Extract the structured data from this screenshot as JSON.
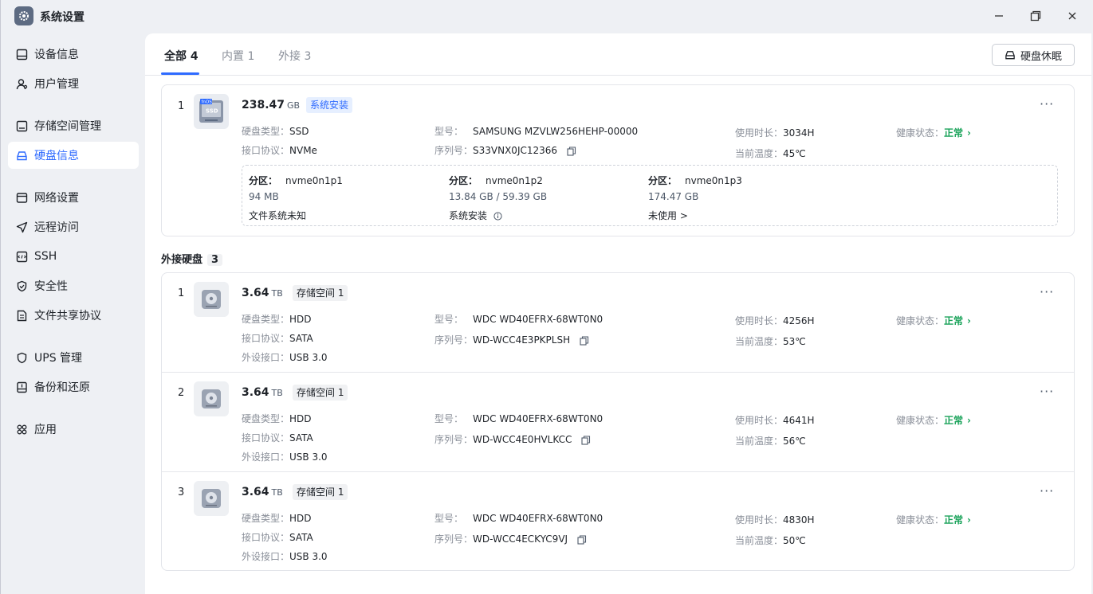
{
  "app": {
    "title": "系统设置"
  },
  "sidebar": {
    "items": [
      {
        "label": "设备信息",
        "icon": "device-info-icon"
      },
      {
        "label": "用户管理",
        "icon": "user-icon"
      },
      {
        "label": "存储空间管理",
        "icon": "storage-icon"
      },
      {
        "label": "硬盘信息",
        "icon": "disk-icon",
        "active": true
      },
      {
        "label": "网络设置",
        "icon": "network-icon"
      },
      {
        "label": "远程访问",
        "icon": "remote-icon"
      },
      {
        "label": "SSH",
        "icon": "ssh-icon"
      },
      {
        "label": "安全性",
        "icon": "shield-icon"
      },
      {
        "label": "文件共享协议",
        "icon": "file-share-icon"
      },
      {
        "label": "UPS 管理",
        "icon": "ups-icon"
      },
      {
        "label": "备份和还原",
        "icon": "backup-icon"
      },
      {
        "label": "应用",
        "icon": "apps-icon"
      }
    ]
  },
  "tabs": [
    {
      "label": "全部 4",
      "active": true
    },
    {
      "label": "内置 1"
    },
    {
      "label": "外接 3"
    }
  ],
  "toolbar": {
    "sleep_label": "硬盘休眠"
  },
  "labels": {
    "type": "硬盘类型：",
    "iface": "接口协议：",
    "ext_iface": "外设接口：",
    "model": "型号：",
    "serial": "序列号：",
    "uptime": "使用时长：",
    "temp": "当前温度：",
    "health": "健康状态：",
    "partition": "分区：",
    "more": "···"
  },
  "internal_disk": {
    "index": "1",
    "icon_text": "fnOS",
    "icon_sub": "SSD",
    "capacity": "238.47",
    "unit": "GB",
    "badge": "系统安装",
    "type": "SSD",
    "iface": "NVMe",
    "model": "SAMSUNG MZVLW256HEHP-00000",
    "serial": "S33VNX0JC12366",
    "uptime": "3034H",
    "temp": "45℃",
    "health": "正常",
    "partitions": [
      {
        "name": "nvme0n1p1",
        "size": "94 MB",
        "fs": "文件系统未知"
      },
      {
        "name": "nvme0n1p2",
        "size": "13.84 GB / 59.39 GB",
        "fs": "系统安装"
      },
      {
        "name": "nvme0n1p3",
        "size": "174.47 GB",
        "fs": "未使用 >"
      }
    ]
  },
  "external_section": {
    "title": "外接硬盘",
    "count": "3"
  },
  "external_disks": [
    {
      "index": "1",
      "capacity": "3.64",
      "unit": "TB",
      "badge": "存储空间 1",
      "type": "HDD",
      "iface": "SATA",
      "ext_iface": "USB 3.0",
      "model": "WDC WD40EFRX-68WT0N0",
      "serial": "WD-WCC4E3PKPLSH",
      "uptime": "4256H",
      "temp": "53℃",
      "health": "正常"
    },
    {
      "index": "2",
      "capacity": "3.64",
      "unit": "TB",
      "badge": "存储空间 1",
      "type": "HDD",
      "iface": "SATA",
      "ext_iface": "USB 3.0",
      "model": "WDC WD40EFRX-68WT0N0",
      "serial": "WD-WCC4E0HVLKCC",
      "uptime": "4641H",
      "temp": "56℃",
      "health": "正常"
    },
    {
      "index": "3",
      "capacity": "3.64",
      "unit": "TB",
      "badge": "存储空间 1",
      "type": "HDD",
      "iface": "SATA",
      "ext_iface": "USB 3.0",
      "model": "WDC WD40EFRX-68WT0N0",
      "serial": "WD-WCC4ECKYC9VJ",
      "uptime": "4830H",
      "temp": "50℃",
      "health": "正常"
    }
  ],
  "colors": {
    "accent": "#2f6bff",
    "healthy": "#1aa35a"
  }
}
